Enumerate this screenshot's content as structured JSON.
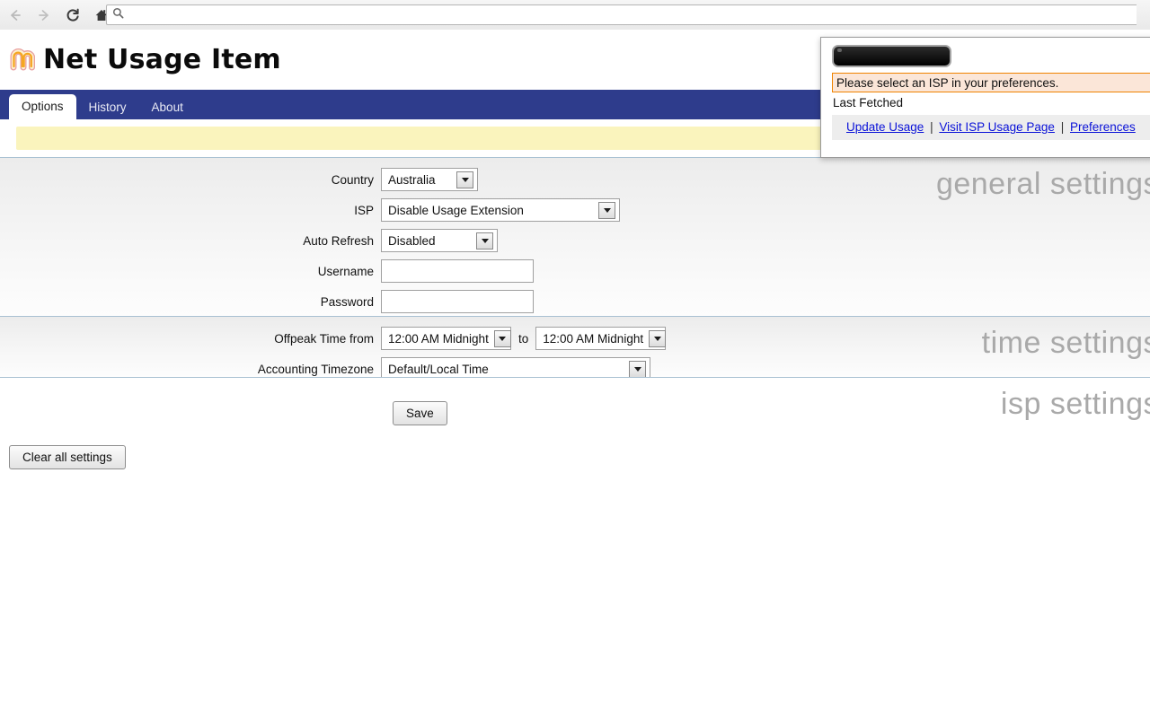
{
  "browser": {
    "back_icon": "arrow-left-icon",
    "forward_icon": "arrow-right-icon",
    "reload_icon": "reload-icon",
    "home_icon": "home-icon",
    "search_icon": "search-icon",
    "address_value": "",
    "address_placeholder": ""
  },
  "header": {
    "title": "Net Usage Item",
    "logo_icon": "net-usage-item-logo-icon"
  },
  "tabs": [
    {
      "label": "Options",
      "active": true
    },
    {
      "label": "History",
      "active": false
    },
    {
      "label": "About",
      "active": false
    }
  ],
  "notice": {
    "text": ""
  },
  "sections": {
    "general": {
      "watermark": "general settings",
      "fields": {
        "country_label": "Country",
        "country_value": "Australia",
        "isp_label": "ISP",
        "isp_value": "Disable Usage Extension",
        "auto_refresh_label": "Auto Refresh",
        "auto_refresh_value": "Disabled",
        "username_label": "Username",
        "username_value": "",
        "password_label": "Password",
        "password_value": ""
      }
    },
    "time": {
      "watermark": "time settings",
      "fields": {
        "offpeak_label": "Offpeak Time from",
        "offpeak_from_value": "12:00 AM Midnight",
        "offpeak_to_label": "to",
        "offpeak_to_value": "12:00 AM Midnight",
        "timezone_label": "Accounting Timezone",
        "timezone_value": "Default/Local Time"
      }
    },
    "isp": {
      "watermark": "isp settings",
      "save_label": "Save",
      "clear_label": "Clear all settings"
    }
  },
  "popup": {
    "usage_bar_label": "",
    "warning": "Please select an ISP in your preferences.",
    "last_fetched": "Last Fetched",
    "links": [
      {
        "label": "Update Usage"
      },
      {
        "label": "Visit ISP Usage Page"
      },
      {
        "label": "Preferences"
      }
    ],
    "separator": "|"
  },
  "colors": {
    "tabbar_blue": "#2e3c8c",
    "notice_yellow": "#faf4bd",
    "warning_border": "#f08300",
    "warning_bg": "#fbe6d8",
    "link_blue": "#0a12d8",
    "section_border": "#a9c1d2",
    "watermark_gray": "#a9a9a9"
  }
}
